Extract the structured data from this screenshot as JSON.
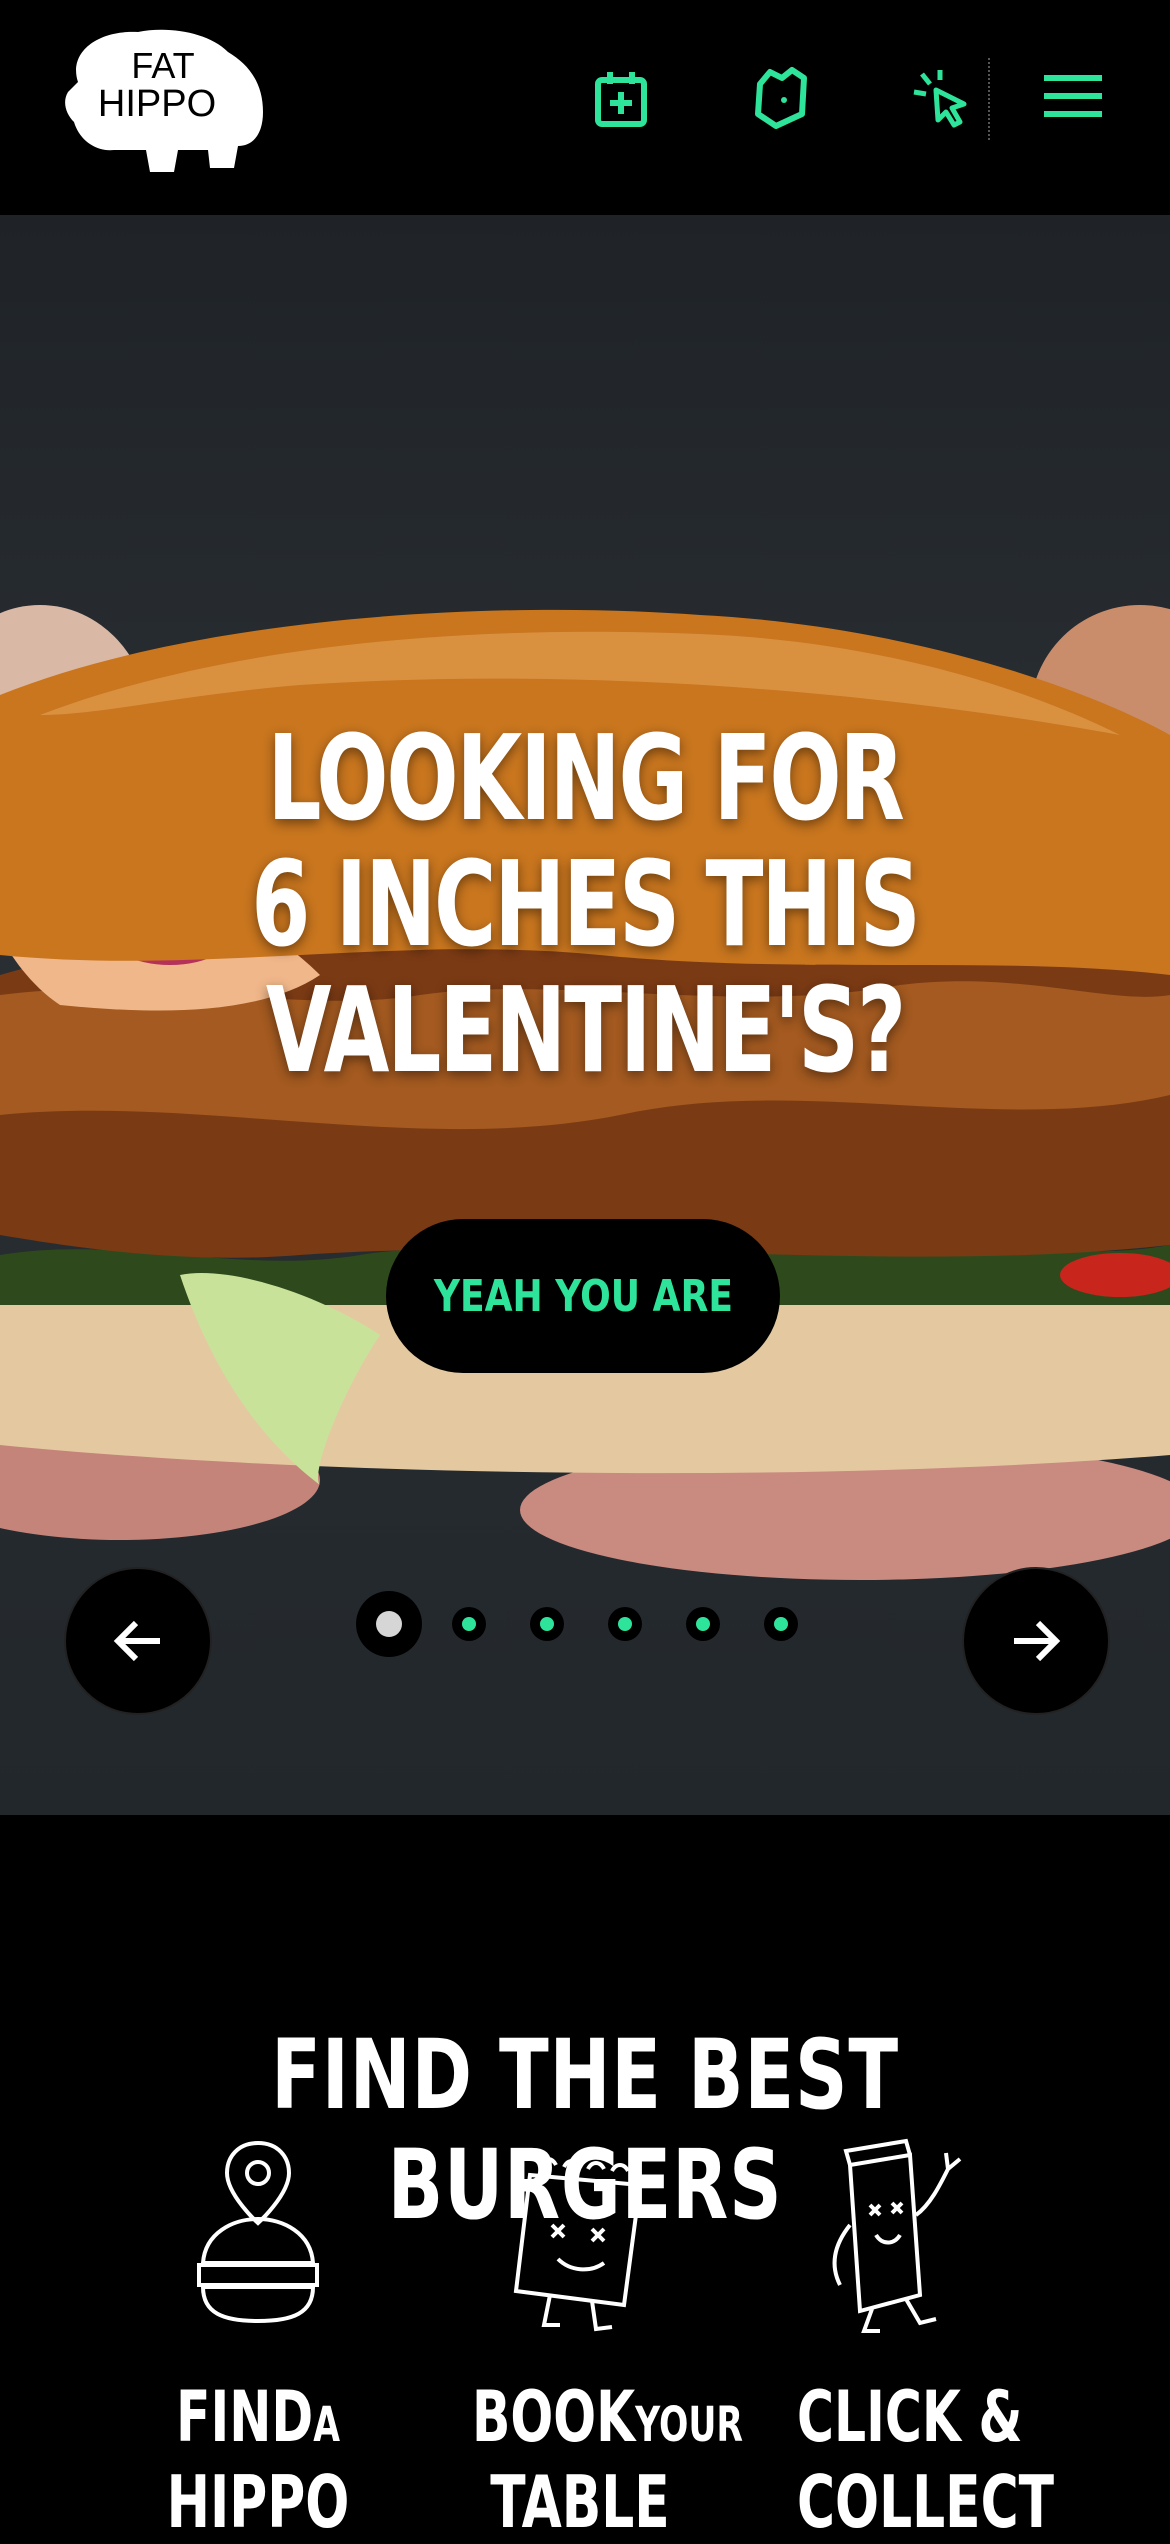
{
  "brand": {
    "logo_line1": "FAT",
    "logo_line2": "HIPPO"
  },
  "header": {
    "icons": [
      "calendar-plus-icon",
      "delivery-bag-icon",
      "click-collect-icon",
      "hamburger-menu-icon"
    ],
    "accent": "#2ee39a"
  },
  "hero": {
    "title": "LOOKING FOR 6 INCHES THIS VALENTINE'S?",
    "cta_label": "YEAH YOU ARE",
    "slides_total": 6,
    "active_slide": 1
  },
  "section": {
    "title": "FIND THE BEST BURGERS",
    "features": [
      {
        "big": "FIND",
        "small": "A",
        "line2": "HIPPO",
        "icon": "burger-location-icon"
      },
      {
        "big": "BOOK",
        "small": "YOUR",
        "line2": "TABLE",
        "icon": "calendar-character-icon"
      },
      {
        "big": "CLICK &",
        "small": "",
        "line2": "COLLECT",
        "icon": "takeaway-bag-character-icon"
      }
    ]
  },
  "colors": {
    "background": "#000000",
    "accent": "#2ee39a",
    "text": "#ffffff"
  }
}
